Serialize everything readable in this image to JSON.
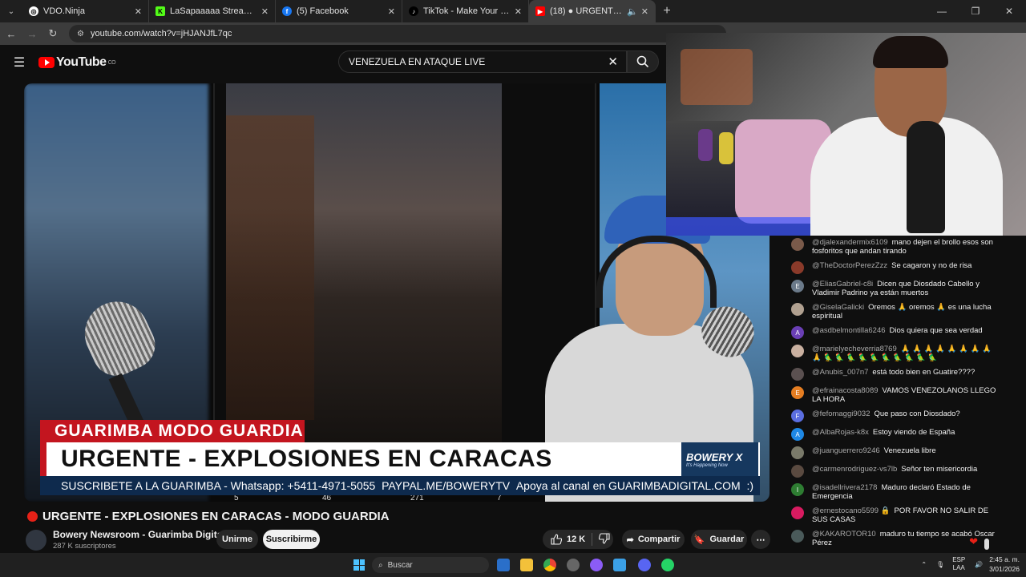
{
  "browser": {
    "tabs": [
      {
        "title": "VDO.Ninja",
        "favicon_color": "#ffffff"
      },
      {
        "title": "LaSapaaaaa Stream - Watch Liv",
        "favicon_color": "#53fc18"
      },
      {
        "title": "(5) Facebook",
        "favicon_color": "#1877f2"
      },
      {
        "title": "TikTok - Make Your Day",
        "favicon_color": "#000000"
      },
      {
        "title": "(18) ● URGENTE - EXPLOS",
        "favicon_color": "#ff0000"
      }
    ],
    "url": "youtube.com/watch?v=jHJANJfL7qc"
  },
  "youtube": {
    "logo_text": "YouTube",
    "logo_region": "CO",
    "search_query": "VENEZUELA EN ATAQUE LIVE"
  },
  "video_overlay": {
    "tag": "GUARIMBA MODO GUARDIA",
    "headline": "URGENTE - EXPLOSIONES EN CARACAS",
    "brand": "BOWERY X",
    "brand_tagline": "It's Happening Now",
    "ticker_left": "SUSCRIBETE A LA GUARIMBA - Whatsapp: +5411-4971-5055",
    "ticker_mid": "PAYPAL.ME/BOWERYTV",
    "ticker_right": "Apoya al canal en GUARIMBADIGITAL.COM",
    "stats": [
      "5",
      "46",
      "271",
      "7"
    ]
  },
  "video": {
    "title": "URGENTE - EXPLOSIONES EN CARACAS - MODO GUARDIA",
    "channel": "Bowery Newsroom - Guarimba Digital",
    "subscribers": "287 K suscriptores",
    "join_label": "Unirme",
    "subscribe_label": "Suscribirme",
    "likes": "12 K",
    "share_label": "Compartir",
    "save_label": "Guardar"
  },
  "chat": [
    {
      "author": "@djalexandermix6109",
      "text": "mano dejen el brollo esos son fosforitos que andan tirando",
      "avatar_color": "#7a5a4a",
      "initial": ""
    },
    {
      "author": "@TheDoctorPerezZzz",
      "text": "Se cagaron y no de risa",
      "avatar_color": "#8a3a2a",
      "initial": ""
    },
    {
      "author": "@EliasGabriel-c8i",
      "text": "Dicen que Diosdado Cabello y Vladimir Padrino ya están muertos",
      "avatar_color": "#6b7a8a",
      "initial": "E"
    },
    {
      "author": "@GiselaGalicki",
      "text": "Oremos 🙏 oremos 🙏 es una lucha espiritual",
      "avatar_color": "#b0a090",
      "initial": ""
    },
    {
      "author": "@asdbelmontilla6246",
      "text": "Dios quiera que sea verdad",
      "avatar_color": "#6a3fb5",
      "initial": "A"
    },
    {
      "author": "@marielyecheverria8769",
      "text": "🙏 🙏 🙏 🙏 🙏 🙏 🙏 🙏 🙏 🦜 🦜 🦜 🦜 🦜 🦜 🦜 🦜 🦜 🦜",
      "avatar_color": "#c9b0a0",
      "initial": ""
    },
    {
      "author": "@Anubis_007n7",
      "text": "está todo bien en Guatire????",
      "avatar_color": "#5a5050",
      "initial": ""
    },
    {
      "author": "@efrainacosta8089",
      "text": "VAMOS VENEZOLANOS LLEGO LA HORA",
      "avatar_color": "#e67e22",
      "initial": "E"
    },
    {
      "author": "@fefomaggi9032",
      "text": "Que paso con Diosdado?",
      "avatar_color": "#5b6ee1",
      "initial": "F"
    },
    {
      "author": "@AlbaRojas-k8x",
      "text": "Estoy viendo de España",
      "avatar_color": "#1e88e5",
      "initial": "A"
    },
    {
      "author": "@juanguerrero9246",
      "text": "Venezuela libre",
      "avatar_color": "#7a7a6a",
      "initial": ""
    },
    {
      "author": "@carmenrodriguez-vs7lb",
      "text": "Señor ten misericordia",
      "avatar_color": "#5a4a40",
      "initial": ""
    },
    {
      "author": "@isadellrivera2178",
      "text": "Maduro declaró Estado de Emergencia",
      "avatar_color": "#2e7d32",
      "initial": "I"
    },
    {
      "author": "@ernestocano5599 🔒",
      "text": "POR FAVOR NO SALIR DE SUS CASAS",
      "avatar_color": "#d81b60",
      "initial": ""
    },
    {
      "author": "@KAKAROTOR10",
      "text": "maduro tu tiempo se acabó Oscar Pérez",
      "avatar_color": "#4a5a5a",
      "initial": ""
    }
  ],
  "taskbar": {
    "search_label": "Buscar",
    "lang_1": "ESP",
    "lang_2": "LAA",
    "time": "2:45 a. m.",
    "date": "3/01/2026"
  }
}
